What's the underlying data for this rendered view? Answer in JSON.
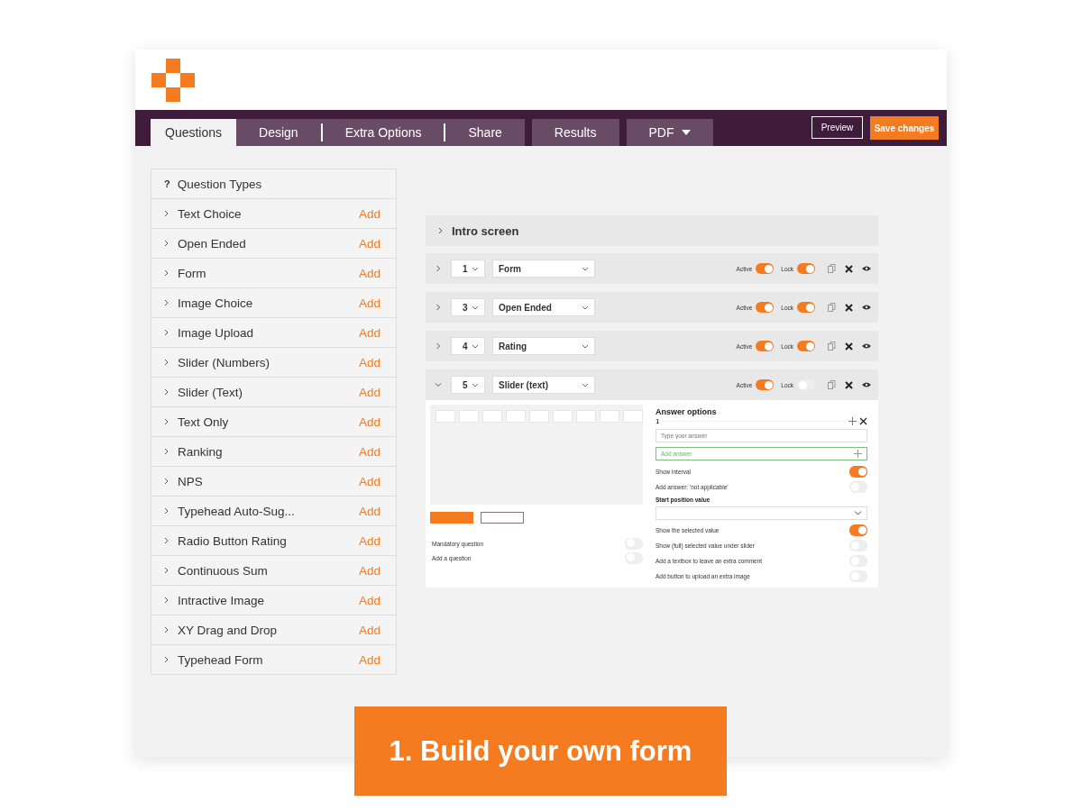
{
  "tabs": [
    {
      "label": "Questions",
      "selected": true,
      "dropdown": false
    },
    {
      "label": "Design",
      "selected": false,
      "dropdown": false
    },
    {
      "label": "Extra Options",
      "selected": false,
      "dropdown": false
    },
    {
      "label": "Share",
      "selected": false,
      "dropdown": false
    },
    {
      "label": "Results",
      "selected": false,
      "dropdown": false
    },
    {
      "label": "PDF",
      "selected": false,
      "dropdown": true
    }
  ],
  "header_buttons": {
    "preview": "Preview",
    "save": "Save changes"
  },
  "question_types": {
    "mark": "?",
    "title": "Question Types",
    "items": [
      {
        "label": "Text Choice",
        "action": "Add"
      },
      {
        "label": "Open Ended",
        "action": "Add"
      },
      {
        "label": "Form",
        "action": "Add"
      },
      {
        "label": "Image Choice",
        "action": "Add"
      },
      {
        "label": "Image Upload",
        "action": "Add"
      },
      {
        "label": "Slider (Numbers)",
        "action": "Add"
      },
      {
        "label": "Slider (Text)",
        "action": "Add"
      },
      {
        "label": "Text Only",
        "action": "Add"
      },
      {
        "label": "Ranking",
        "action": "Add"
      },
      {
        "label": "NPS",
        "action": "Add"
      },
      {
        "label": "Typehead Auto-Sug...",
        "action": "Add"
      },
      {
        "label": "Radio Button Rating",
        "action": "Add"
      },
      {
        "label": "Continuous Sum",
        "action": "Add"
      },
      {
        "label": "Intractive Image",
        "action": "Add"
      },
      {
        "label": "XY Drag and Drop",
        "action": "Add"
      },
      {
        "label": "Typehead Form",
        "action": "Add"
      }
    ]
  },
  "intro": {
    "label": "Intro screen"
  },
  "questions": [
    {
      "number": "1",
      "type": "Form",
      "expanded": false,
      "active_label": "Active",
      "active": true,
      "lock_label": "Lock",
      "lock": true
    },
    {
      "number": "3",
      "type": "Open Ended",
      "expanded": false,
      "active_label": "Active",
      "active": true,
      "lock_label": "Lock",
      "lock": true
    },
    {
      "number": "4",
      "type": "Rating",
      "expanded": false,
      "active_label": "Active",
      "active": true,
      "lock_label": "Lock",
      "lock": true
    },
    {
      "number": "5",
      "type": "Slider (text)",
      "expanded": true,
      "active_label": "Active",
      "active": true,
      "lock_label": "Lock",
      "lock": false
    }
  ],
  "detail": {
    "left_options": [
      {
        "label": "Mandatory question",
        "on": false
      },
      {
        "label": "Add a question",
        "on": false
      }
    ],
    "answer_title": "Answer options",
    "answer_index": "1",
    "answer_placeholder": "Type your answer",
    "add_placeholder": "Add answer",
    "options_a": [
      {
        "label": "Show interval",
        "on": true
      },
      {
        "label": "Add answer: 'not applicable'",
        "on": false
      }
    ],
    "start_label": "Start position value",
    "options_b": [
      {
        "label": "Show the selected value",
        "on": true
      },
      {
        "label": "Show (full) selected value under slider",
        "on": false
      },
      {
        "label": "Add a textbox to leave an extra comment",
        "on": false
      },
      {
        "label": "Add button to upload an extra image",
        "on": false
      }
    ]
  },
  "banner": "1. Build your own form"
}
